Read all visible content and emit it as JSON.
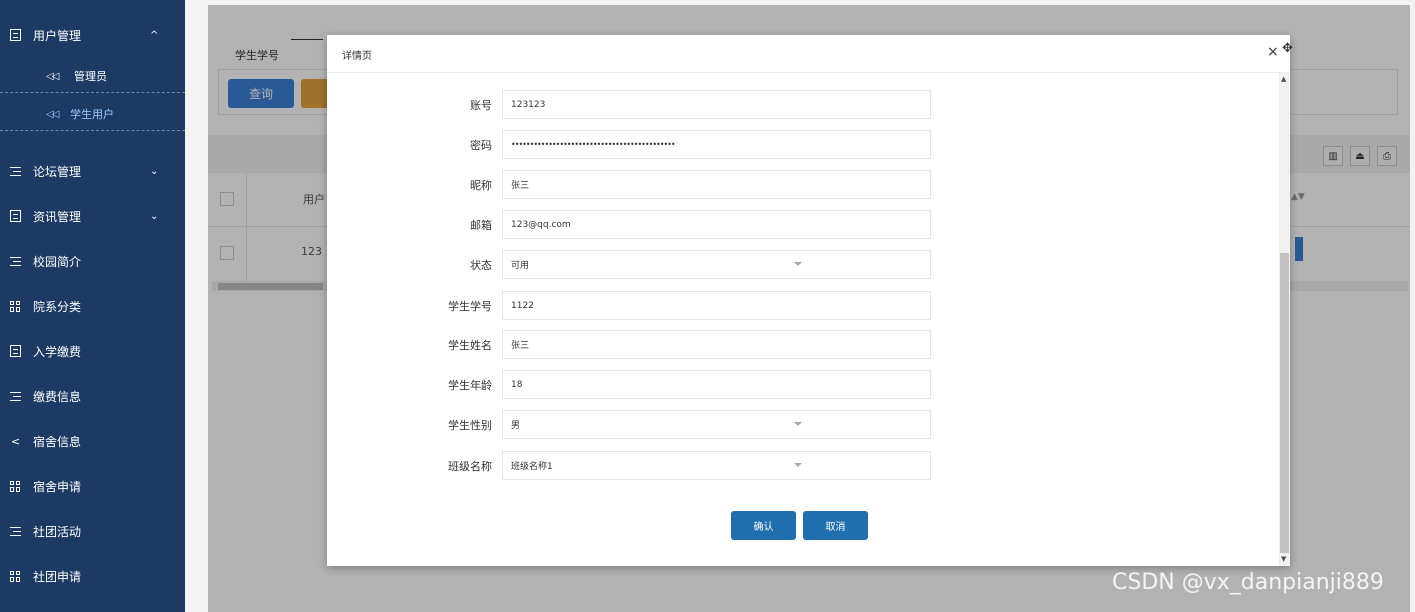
{
  "sidebar": {
    "group_user": {
      "label": "用户管理",
      "chevron": "^",
      "icon": "book-icon"
    },
    "sub_items": [
      {
        "label": "管理员",
        "arrow": "◁◁"
      },
      {
        "label": "学生用户",
        "arrow": "◁◁"
      }
    ],
    "items": [
      {
        "label": "论坛管理",
        "icon": "list-icon",
        "chevron": "⌄"
      },
      {
        "label": "资讯管理",
        "icon": "book-icon",
        "chevron": "⌄"
      },
      {
        "label": "校园简介",
        "icon": "list-icon"
      },
      {
        "label": "院系分类",
        "icon": "grid-icon"
      },
      {
        "label": "入学缴费",
        "icon": "book-icon"
      },
      {
        "label": "缴费信息",
        "icon": "list-icon"
      },
      {
        "label": "宿舍信息",
        "icon": "share-icon"
      },
      {
        "label": "宿舍申请",
        "icon": "grid-icon"
      },
      {
        "label": "社团活动",
        "icon": "list-icon"
      },
      {
        "label": "社团申请",
        "icon": "grid-icon"
      }
    ]
  },
  "main": {
    "query_label": "学生学号",
    "query_button": "查询",
    "table_header_user": "用户",
    "table_cell_account": "123"
  },
  "dialog": {
    "title": "详情页",
    "close": "×",
    "move": "✥",
    "fields": [
      {
        "label": "账号",
        "value": "123123"
      },
      {
        "label": "密码",
        "value": "••••••••••••••••••••••••••••••••••••••••••••"
      },
      {
        "label": "昵称",
        "value": "张三"
      },
      {
        "label": "邮箱",
        "value": "123@qq.com"
      },
      {
        "label": "状态",
        "value": "可用",
        "select": true
      },
      {
        "label": "学生学号",
        "value": "1122"
      },
      {
        "label": "学生姓名",
        "value": "张三"
      },
      {
        "label": "学生年龄",
        "value": "18"
      },
      {
        "label": "学生性别",
        "value": "男",
        "select": true
      },
      {
        "label": "班级名称",
        "value": "班级名称1",
        "select": true
      }
    ],
    "confirm_button": "确认",
    "cancel_button": "取消"
  },
  "watermark": "CSDN @vx_danpianji889"
}
